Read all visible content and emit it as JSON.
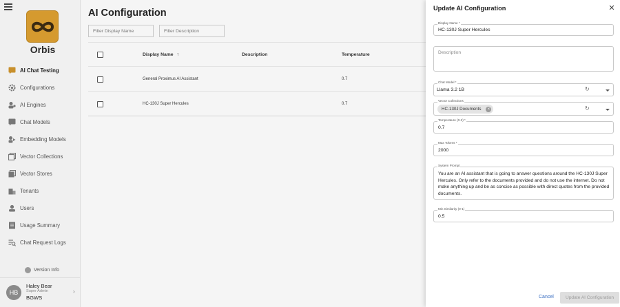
{
  "app": {
    "brand": "Orbis",
    "brand_color": "#d59a2f"
  },
  "sidebar": {
    "items": [
      {
        "label": "AI Chat Testing",
        "icon": "chat-bubble-icon",
        "active": true
      },
      {
        "label": "Configurations",
        "icon": "gear-icon"
      },
      {
        "label": "AI Engines",
        "icon": "engine-icon"
      },
      {
        "label": "Chat Models",
        "icon": "chat-model-icon"
      },
      {
        "label": "Embedding Models",
        "icon": "embedding-icon"
      },
      {
        "label": "Vector Collections",
        "icon": "collection-icon"
      },
      {
        "label": "Vector Stores",
        "icon": "store-icon"
      },
      {
        "label": "Tenants",
        "icon": "tenants-icon"
      },
      {
        "label": "Users",
        "icon": "user-icon"
      },
      {
        "label": "Usage Summary",
        "icon": "summary-icon"
      },
      {
        "label": "Chat Request Logs",
        "icon": "logs-icon"
      }
    ],
    "version_label": "Version Info",
    "user": {
      "initials": "HB",
      "name": "Haley Bear",
      "role": "Super Admin",
      "org": "BGWS"
    }
  },
  "main": {
    "title": "AI Configuration",
    "filters": {
      "display_name_placeholder": "Filter Display Name",
      "description_placeholder": "Filter Description"
    },
    "table": {
      "headers": {
        "display_name": "Display Name",
        "description": "Description",
        "temperature": "Temperature"
      },
      "sort_indicator": "↑",
      "rows": [
        {
          "display_name": "General Proximus AI Assistant",
          "description": "",
          "temperature": "0.7"
        },
        {
          "display_name": "HC-130J Super Hercules",
          "description": "",
          "temperature": "0.7"
        }
      ]
    }
  },
  "panel": {
    "title": "Update AI Configuration",
    "close_glyph": "✕",
    "display_name": {
      "label": "Display Name *",
      "value": "HC-130J Super Hercules"
    },
    "description": {
      "placeholder": "Description"
    },
    "chat_model": {
      "label": "Chat Model *",
      "value": "Llama 3.2 1B"
    },
    "vector_collections": {
      "label": "Vector Collections",
      "chip": "HC-130J Documents"
    },
    "temperature": {
      "label": "Temperature (0-2) *",
      "value": "0.7"
    },
    "max_tokens": {
      "label": "Max Tokens *",
      "value": "2000"
    },
    "system_prompt": {
      "label": "System Prompt",
      "value": "You are an AI assistant that is going to answer questions around the HC-130J Super Hercules. Only refer to the documents provided and do not use the internet. Do not make anything up and be as concise as possible with direct quotes from the provided documents."
    },
    "min_similarity": {
      "label": "Min Similarity (0-1)",
      "value": "0.5"
    },
    "cancel_label": "Cancel",
    "submit_label": "Update AI Configuration",
    "accent_color": "#3b6fc2"
  }
}
